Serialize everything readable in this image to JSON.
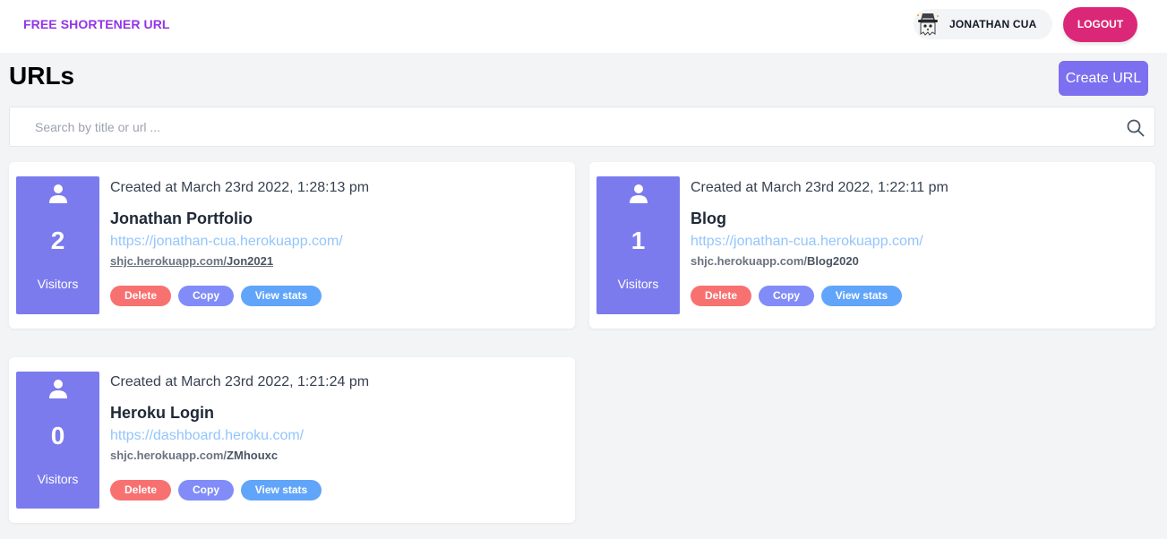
{
  "navbar": {
    "brand": "FREE SHORTENER URL",
    "user_name": "JONATHAN CUA",
    "logout_label": "LOGOUT"
  },
  "page": {
    "title": "URLs",
    "create_label": "Create URL"
  },
  "search": {
    "placeholder": "Search by title or url ...",
    "value": ""
  },
  "cards": [
    {
      "created": "Created at March 23rd 2022, 1:28:13 pm",
      "title": "Jonathan Portfolio",
      "url": "https://jonathan-cua.herokuapp.com/",
      "short_domain": "shjc.herokuapp.com/",
      "slug": "Jon2021",
      "visitors": "2",
      "visitors_label": "Visitors",
      "delete_label": "Delete",
      "copy_label": "Copy",
      "stats_label": "View stats"
    },
    {
      "created": "Created at March 23rd 2022, 1:22:11 pm",
      "title": "Blog",
      "url": "https://jonathan-cua.herokuapp.com/",
      "short_domain": "shjc.herokuapp.com/",
      "slug": "Blog2020",
      "visitors": "1",
      "visitors_label": "Visitors",
      "delete_label": "Delete",
      "copy_label": "Copy",
      "stats_label": "View stats"
    },
    {
      "created": "Created at March 23rd 2022, 1:21:24 pm",
      "title": "Heroku Login",
      "url": "https://dashboard.heroku.com/",
      "short_domain": "shjc.herokuapp.com/",
      "slug": "ZMhouxc",
      "visitors": "0",
      "visitors_label": "Visitors",
      "delete_label": "Delete",
      "copy_label": "Copy",
      "stats_label": "View stats"
    }
  ],
  "colors": {
    "brand": "#9333ea",
    "logout": "#db2777",
    "create": "#7c6ff0",
    "visitors_box": "#7b7bee",
    "delete": "#f87171",
    "copy": "#818cf8",
    "stats": "#60a5fa",
    "link": "#93c5fd"
  },
  "icons": {
    "avatar": "detective-ghost-avatar",
    "search": "search-icon",
    "visitors": "person-icon"
  }
}
